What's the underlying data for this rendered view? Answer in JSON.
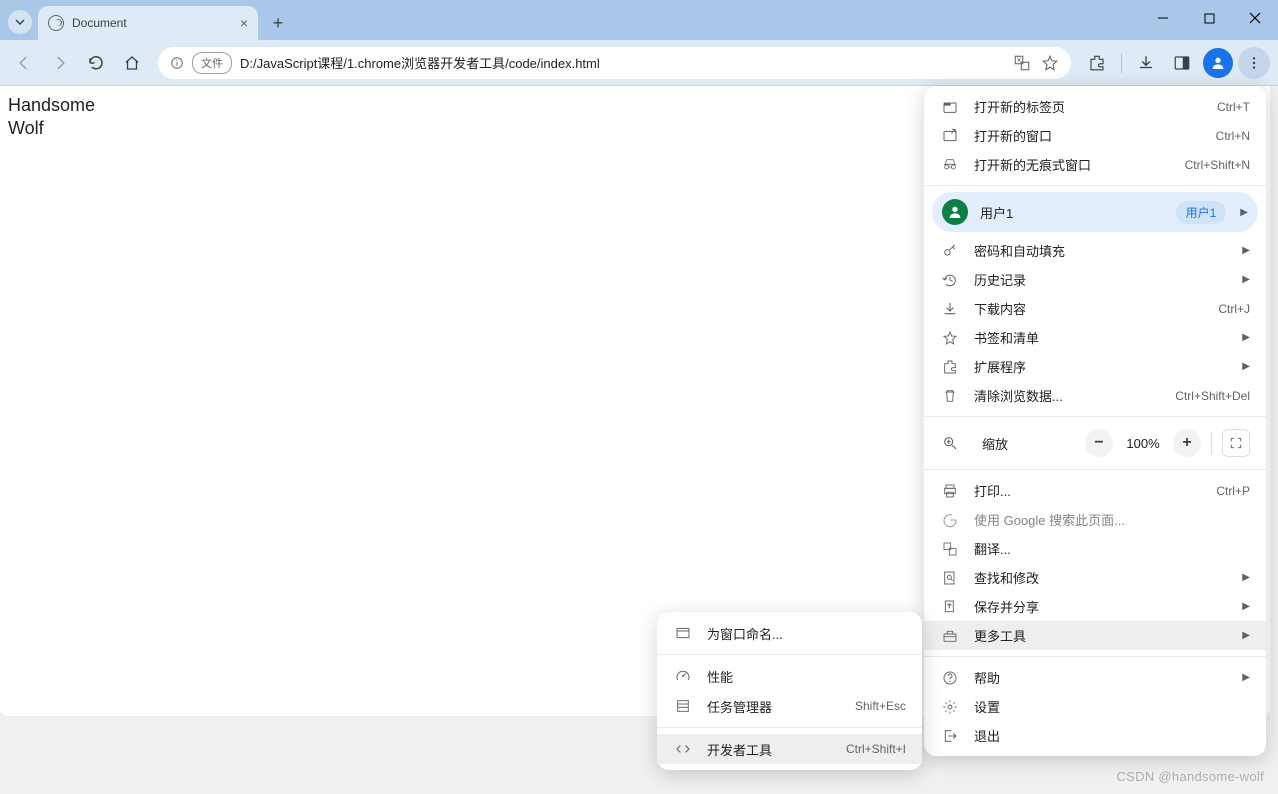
{
  "tab": {
    "title": "Document"
  },
  "addressbar": {
    "chip_label": "文件",
    "url": "D:/JavaScript课程/1.chrome浏览器开发者工具/code/index.html"
  },
  "page_content": {
    "line1": "Handsome",
    "line2": "Wolf"
  },
  "menu": {
    "new_tab": "打开新的标签页",
    "new_tab_sc": "Ctrl+T",
    "new_window": "打开新的窗口",
    "new_window_sc": "Ctrl+N",
    "incognito": "打开新的无痕式窗口",
    "incognito_sc": "Ctrl+Shift+N",
    "user": "用户1",
    "user_badge": "用户1",
    "passwords": "密码和自动填充",
    "history": "历史记录",
    "downloads": "下载内容",
    "downloads_sc": "Ctrl+J",
    "bookmarks": "书签和清单",
    "extensions": "扩展程序",
    "clear_data": "清除浏览数据...",
    "clear_data_sc": "Ctrl+Shift+Del",
    "zoom": "缩放",
    "zoom_pct": "100%",
    "print": "打印...",
    "print_sc": "Ctrl+P",
    "google_search": "使用 Google 搜索此页面...",
    "translate": "翻译...",
    "find_edit": "查找和修改",
    "save_share": "保存并分享",
    "more_tools": "更多工具",
    "help": "帮助",
    "settings": "设置",
    "exit": "退出"
  },
  "submenu": {
    "name_window": "为窗口命名...",
    "performance": "性能",
    "task_manager": "任务管理器",
    "task_manager_sc": "Shift+Esc",
    "dev_tools": "开发者工具",
    "dev_tools_sc": "Ctrl+Shift+I"
  },
  "watermark": "CSDN @handsome-wolf"
}
